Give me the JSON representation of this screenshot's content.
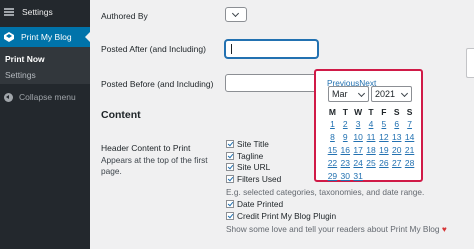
{
  "sidebar": {
    "settings_label": "Settings",
    "active_label": "Print My Blog",
    "submenu": [
      "Print Now",
      "Settings"
    ],
    "collapse_label": "Collapse menu"
  },
  "form": {
    "authored_by_label": "Authored By",
    "posted_after_label": "Posted After (and Including)",
    "posted_before_label": "Posted Before (and Including)",
    "section_heading": "Content",
    "header_content_label": "Header Content to Print",
    "header_content_desc_1": "Appears at the top of the first",
    "header_content_desc_2": "page.",
    "checkboxes": [
      "Site Title",
      "Tagline",
      "Site URL",
      "Filters Used",
      "Date Printed",
      "Credit Print My Blog Plugin"
    ],
    "filters_help": "E.g. selected categories, taxonomies, and date range.",
    "credit_help": "Show some love and tell your readers about Print My Blog"
  },
  "datepicker": {
    "prev_label": "Previous",
    "next_label": "Next",
    "month": "Mar",
    "year": "2021",
    "day_headers": [
      "M",
      "T",
      "W",
      "T",
      "F",
      "S",
      "S"
    ],
    "weeks": [
      [
        "1",
        "2",
        "3",
        "4",
        "5",
        "6",
        "7"
      ],
      [
        "8",
        "9",
        "10",
        "11",
        "12",
        "13",
        "14"
      ],
      [
        "15",
        "16",
        "17",
        "18",
        "19",
        "20",
        "21"
      ],
      [
        "22",
        "23",
        "24",
        "25",
        "26",
        "27",
        "28"
      ],
      [
        "29",
        "30",
        "31",
        "",
        "",
        "",
        ""
      ]
    ]
  },
  "colors": {
    "sidebar_bg": "#23282d",
    "active_bg": "#0073aa",
    "highlight_border": "#d01a47",
    "link": "#2271b1"
  }
}
